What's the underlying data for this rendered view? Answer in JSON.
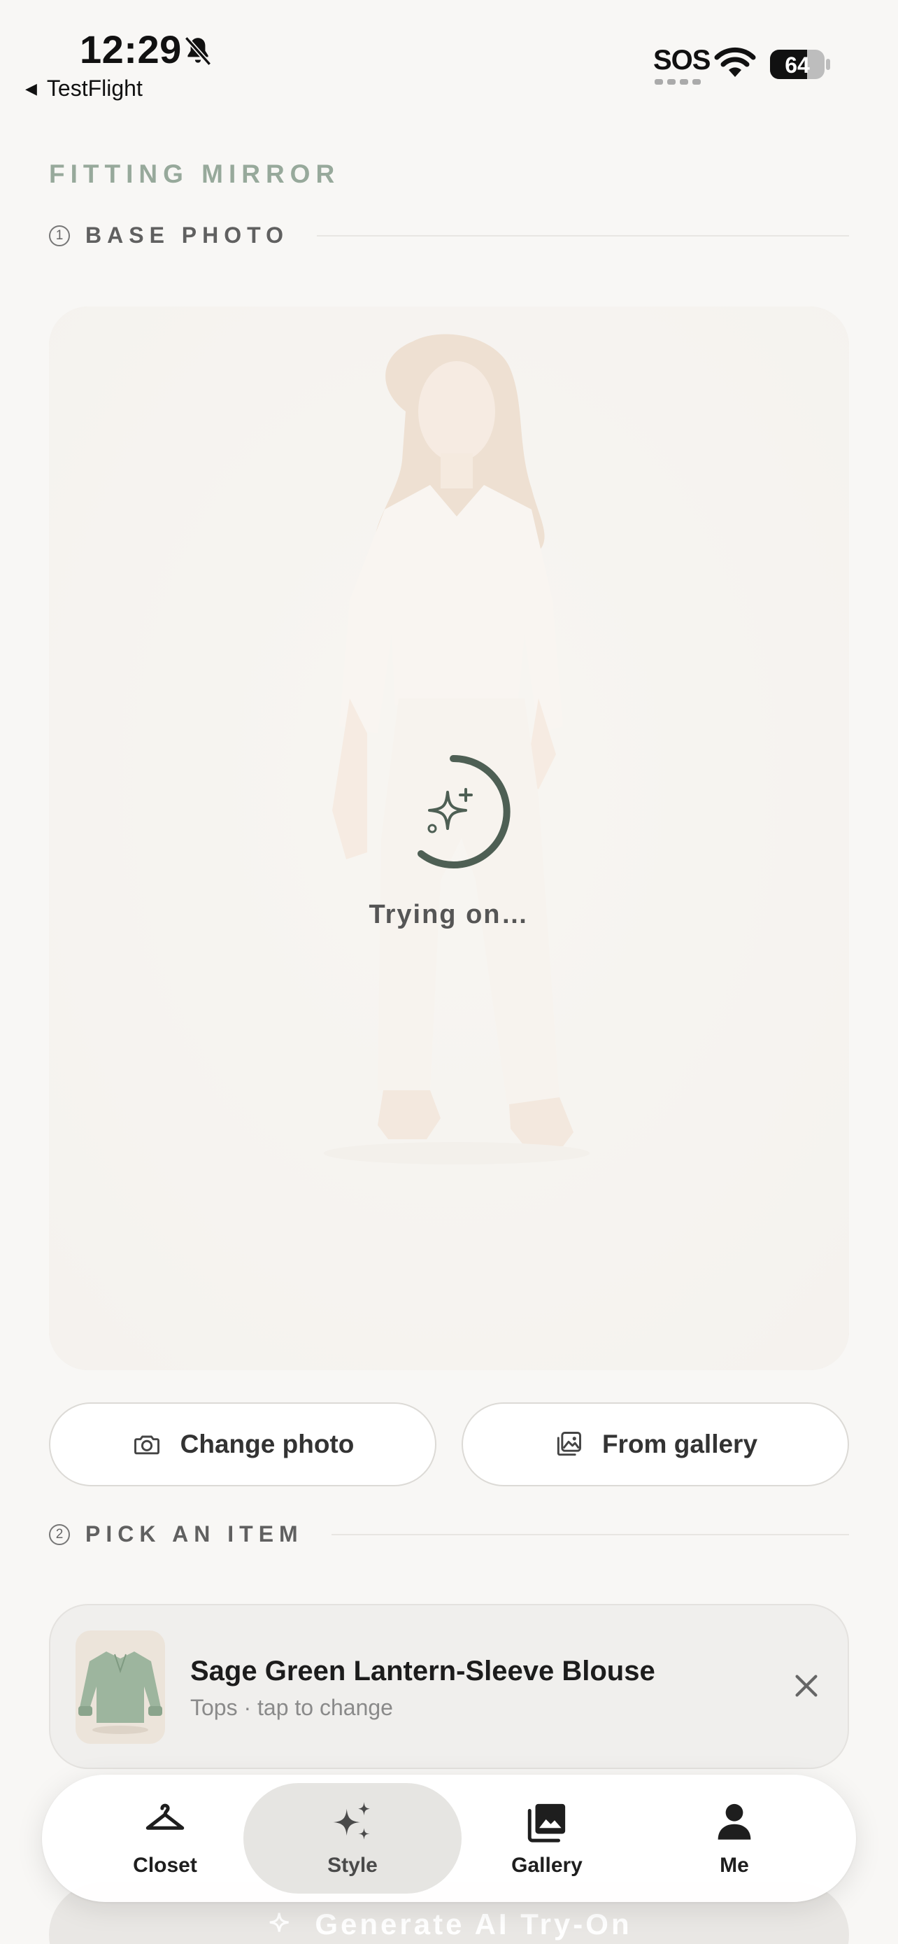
{
  "status_bar": {
    "time": "12:29",
    "back_label": "TestFlight",
    "carrier": "SOS",
    "battery": "64"
  },
  "header": {
    "title": "FITTING MIRROR"
  },
  "base_photo": {
    "step": "1",
    "label": "BASE PHOTO",
    "loading_text": "Trying on…",
    "change_photo_label": "Change photo",
    "from_gallery_label": "From gallery"
  },
  "pick_item": {
    "step": "2",
    "label": "PICK AN ITEM",
    "selected_item": {
      "name": "Sage Green Lantern-Sleeve Blouse",
      "meta": "Tops · tap to change"
    }
  },
  "generate": {
    "label": "Generate AI Try-On"
  },
  "tab_bar": {
    "tabs": [
      {
        "label": "Closet",
        "icon": "hanger-icon"
      },
      {
        "label": "Style",
        "icon": "sparkles-icon",
        "active": true
      },
      {
        "label": "Gallery",
        "icon": "gallery-icon"
      },
      {
        "label": "Me",
        "icon": "person-icon"
      }
    ]
  },
  "colors": {
    "accent": "#4e5f54",
    "title": "#97a99b",
    "background": "#f8f7f5"
  }
}
